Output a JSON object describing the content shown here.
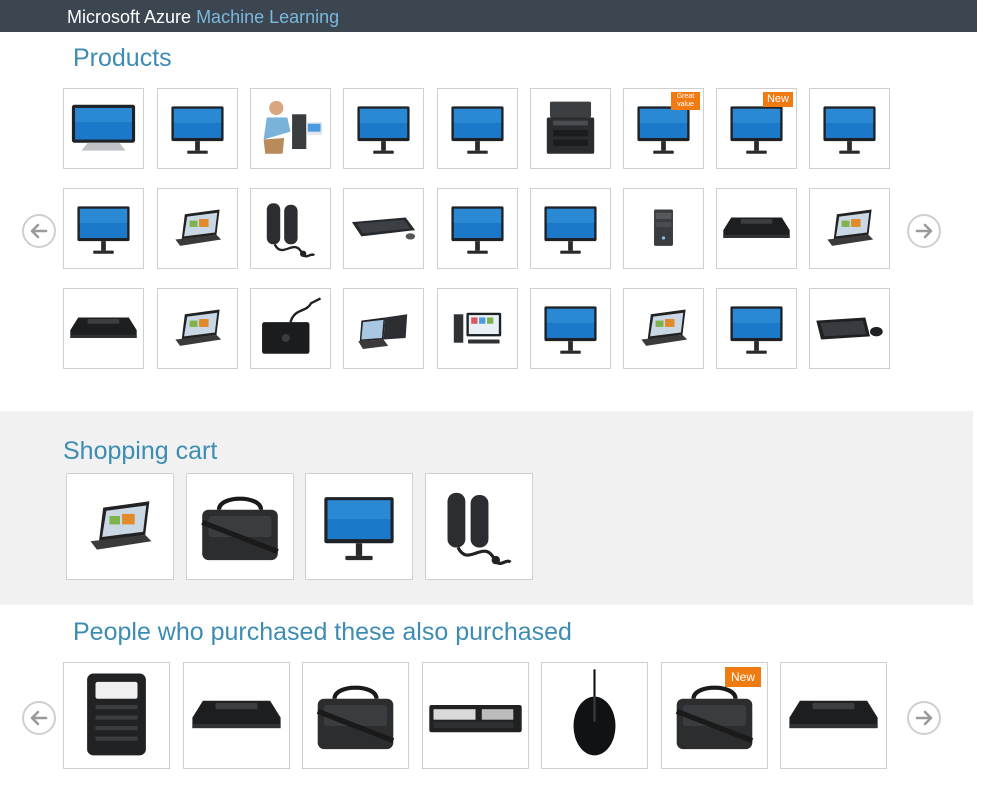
{
  "header": {
    "brand_primary": "Microsoft Azure",
    "brand_secondary": "Machine Learning"
  },
  "sections": {
    "products": {
      "title": "Products",
      "items": [
        {
          "icon": "monitor-touch-icon"
        },
        {
          "icon": "monitor-icon"
        },
        {
          "icon": "technician-desktop-icon"
        },
        {
          "icon": "monitor-icon"
        },
        {
          "icon": "monitor-icon"
        },
        {
          "icon": "printer-icon"
        },
        {
          "icon": "monitor-icon",
          "badge": "Great value"
        },
        {
          "icon": "monitor-icon",
          "badge": "New"
        },
        {
          "icon": "monitor-icon"
        },
        {
          "icon": "monitor-icon"
        },
        {
          "icon": "laptop-icon"
        },
        {
          "icon": "speakers-icon"
        },
        {
          "icon": "keyboard-icon"
        },
        {
          "icon": "monitor-icon"
        },
        {
          "icon": "monitor-icon"
        },
        {
          "icon": "desktop-tower-icon"
        },
        {
          "icon": "docking-station-icon"
        },
        {
          "icon": "laptop-icon"
        },
        {
          "icon": "docking-station-icon"
        },
        {
          "icon": "laptop-icon"
        },
        {
          "icon": "external-drive-icon"
        },
        {
          "icon": "convertible-laptop-icon"
        },
        {
          "icon": "desktop-set-icon"
        },
        {
          "icon": "monitor-icon"
        },
        {
          "icon": "laptop-icon"
        },
        {
          "icon": "monitor-icon"
        },
        {
          "icon": "keyboard-mouse-icon"
        }
      ]
    },
    "cart": {
      "title": "Shopping cart",
      "items": [
        {
          "icon": "laptop-icon"
        },
        {
          "icon": "laptop-bag-icon"
        },
        {
          "icon": "monitor-icon"
        },
        {
          "icon": "speakers-icon"
        }
      ]
    },
    "recommendations": {
      "title": "People who purchased these also purchased",
      "items": [
        {
          "icon": "power-adapter-icon"
        },
        {
          "icon": "docking-station-icon"
        },
        {
          "icon": "laptop-bag-icon"
        },
        {
          "icon": "battery-icon"
        },
        {
          "icon": "mouse-icon"
        },
        {
          "icon": "laptop-bag-icon",
          "badge": "New"
        },
        {
          "icon": "docking-station-icon"
        }
      ]
    }
  },
  "colors": {
    "header_bg": "#3c4651",
    "accent_text": "#3d8cb3",
    "brand_highlight": "#7ab8dc",
    "badge_bg": "#f07b12",
    "cart_bg": "#f1f1f1"
  },
  "icons": {
    "prev": "arrow-left-circle-icon",
    "next": "arrow-right-circle-icon"
  }
}
